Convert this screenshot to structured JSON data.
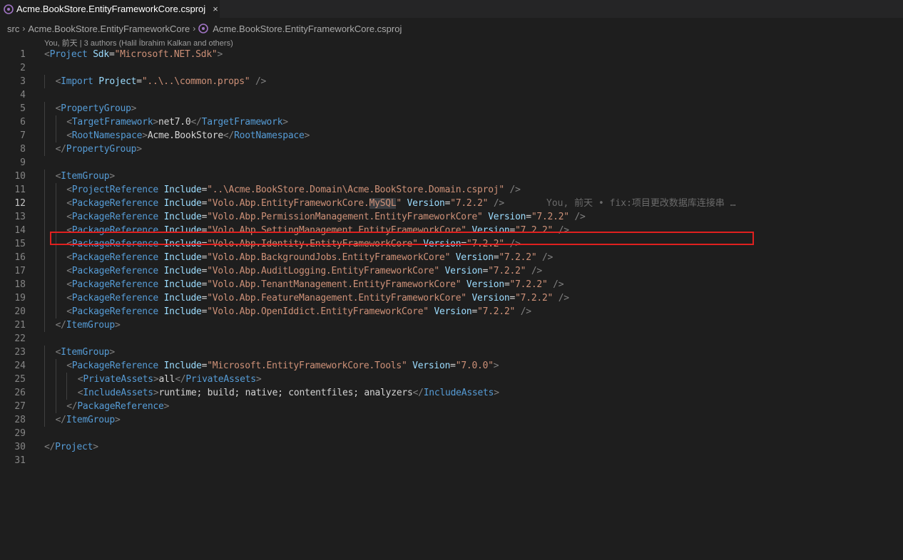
{
  "tab": {
    "icon": "csproj-file-icon",
    "title": "Acme.BookStore.EntityFrameworkCore.csproj",
    "close_glyph": "×"
  },
  "breadcrumb": {
    "items": [
      "src",
      "Acme.BookStore.EntityFrameworkCore",
      "Acme.BookStore.EntityFrameworkCore.csproj"
    ],
    "separator": "›"
  },
  "blame_header": "You, 前天 | 3 authors (Halil İbrahim Kalkan and others)",
  "inline_blame": "You, 前天 • fix:项目更改数据库连接串 …",
  "current_line": 12,
  "colors": {
    "background": "#1e1e1e",
    "tag": "#569cd6",
    "attribute": "#9cdcfe",
    "string": "#ce9178",
    "highlight_box": "#e0201f"
  },
  "lines": [
    {
      "n": "1",
      "indent": 0,
      "tokens": [
        [
          "p",
          "<"
        ],
        [
          "tag",
          "Project"
        ],
        [
          "txt",
          " "
        ],
        [
          "attr",
          "Sdk"
        ],
        [
          "eq",
          "="
        ],
        [
          "str",
          "\"Microsoft.NET.Sdk\""
        ],
        [
          "p",
          ">"
        ]
      ]
    },
    {
      "n": "2",
      "indent": 0,
      "tokens": []
    },
    {
      "n": "3",
      "indent": 1,
      "tokens": [
        [
          "p",
          "<"
        ],
        [
          "tag",
          "Import"
        ],
        [
          "txt",
          " "
        ],
        [
          "attr",
          "Project"
        ],
        [
          "eq",
          "="
        ],
        [
          "str",
          "\"..\\..\\common.props\""
        ],
        [
          "txt",
          " "
        ],
        [
          "p",
          "/>"
        ]
      ]
    },
    {
      "n": "4",
      "indent": 0,
      "tokens": []
    },
    {
      "n": "5",
      "indent": 1,
      "tokens": [
        [
          "p",
          "<"
        ],
        [
          "tag",
          "PropertyGroup"
        ],
        [
          "p",
          ">"
        ]
      ]
    },
    {
      "n": "6",
      "indent": 2,
      "tokens": [
        [
          "p",
          "<"
        ],
        [
          "tag",
          "TargetFramework"
        ],
        [
          "p",
          ">"
        ],
        [
          "txt",
          "net7.0"
        ],
        [
          "p",
          "</"
        ],
        [
          "tag",
          "TargetFramework"
        ],
        [
          "p",
          ">"
        ]
      ]
    },
    {
      "n": "7",
      "indent": 2,
      "tokens": [
        [
          "p",
          "<"
        ],
        [
          "tag",
          "RootNamespace"
        ],
        [
          "p",
          ">"
        ],
        [
          "txt",
          "Acme.BookStore"
        ],
        [
          "p",
          "</"
        ],
        [
          "tag",
          "RootNamespace"
        ],
        [
          "p",
          ">"
        ]
      ]
    },
    {
      "n": "8",
      "indent": 1,
      "tokens": [
        [
          "p",
          "</"
        ],
        [
          "tag",
          "PropertyGroup"
        ],
        [
          "p",
          ">"
        ]
      ]
    },
    {
      "n": "9",
      "indent": 0,
      "tokens": []
    },
    {
      "n": "10",
      "indent": 1,
      "tokens": [
        [
          "p",
          "<"
        ],
        [
          "tag",
          "ItemGroup"
        ],
        [
          "p",
          ">"
        ]
      ]
    },
    {
      "n": "11",
      "indent": 2,
      "tokens": [
        [
          "p",
          "<"
        ],
        [
          "tag",
          "ProjectReference"
        ],
        [
          "txt",
          " "
        ],
        [
          "attr",
          "Include"
        ],
        [
          "eq",
          "="
        ],
        [
          "str",
          "\"..\\Acme.BookStore.Domain\\Acme.BookStore.Domain.csproj\""
        ],
        [
          "txt",
          " "
        ],
        [
          "p",
          "/>"
        ]
      ]
    },
    {
      "n": "12",
      "indent": 2,
      "tokens": [
        [
          "p",
          "<"
        ],
        [
          "tag",
          "PackageReference"
        ],
        [
          "txt",
          " "
        ],
        [
          "attr",
          "Include"
        ],
        [
          "eq",
          "="
        ],
        [
          "str",
          "\"Volo.Abp.EntityFrameworkCore."
        ],
        [
          "strhl",
          "MySQL"
        ],
        [
          "str",
          "\""
        ],
        [
          "txt",
          " "
        ],
        [
          "attr",
          "Version"
        ],
        [
          "eq",
          "="
        ],
        [
          "str",
          "\"7.2.2\""
        ],
        [
          "txt",
          " "
        ],
        [
          "p",
          "/>"
        ]
      ]
    },
    {
      "n": "13",
      "indent": 2,
      "tokens": [
        [
          "p",
          "<"
        ],
        [
          "tag",
          "PackageReference"
        ],
        [
          "txt",
          " "
        ],
        [
          "attr",
          "Include"
        ],
        [
          "eq",
          "="
        ],
        [
          "str",
          "\"Volo.Abp.PermissionManagement.EntityFrameworkCore\""
        ],
        [
          "txt",
          " "
        ],
        [
          "attr",
          "Version"
        ],
        [
          "eq",
          "="
        ],
        [
          "str",
          "\"7.2.2\""
        ],
        [
          "txt",
          " "
        ],
        [
          "p",
          "/>"
        ]
      ]
    },
    {
      "n": "14",
      "indent": 2,
      "tokens": [
        [
          "p",
          "<"
        ],
        [
          "tag",
          "PackageReference"
        ],
        [
          "txt",
          " "
        ],
        [
          "attr",
          "Include"
        ],
        [
          "eq",
          "="
        ],
        [
          "str",
          "\"Volo.Abp.SettingManagement.EntityFrameworkCore\""
        ],
        [
          "txt",
          " "
        ],
        [
          "attr",
          "Version"
        ],
        [
          "eq",
          "="
        ],
        [
          "str",
          "\"7.2.2\""
        ],
        [
          "txt",
          " "
        ],
        [
          "p",
          "/>"
        ]
      ]
    },
    {
      "n": "15",
      "indent": 2,
      "tokens": [
        [
          "p",
          "<"
        ],
        [
          "tag",
          "PackageReference"
        ],
        [
          "txt",
          " "
        ],
        [
          "attr",
          "Include"
        ],
        [
          "eq",
          "="
        ],
        [
          "str",
          "\"Volo.Abp.Identity.EntityFrameworkCore\""
        ],
        [
          "txt",
          " "
        ],
        [
          "attr",
          "Version"
        ],
        [
          "eq",
          "="
        ],
        [
          "str",
          "\"7.2.2\""
        ],
        [
          "txt",
          " "
        ],
        [
          "p",
          "/>"
        ]
      ]
    },
    {
      "n": "16",
      "indent": 2,
      "tokens": [
        [
          "p",
          "<"
        ],
        [
          "tag",
          "PackageReference"
        ],
        [
          "txt",
          " "
        ],
        [
          "attr",
          "Include"
        ],
        [
          "eq",
          "="
        ],
        [
          "str",
          "\"Volo.Abp.BackgroundJobs.EntityFrameworkCore\""
        ],
        [
          "txt",
          " "
        ],
        [
          "attr",
          "Version"
        ],
        [
          "eq",
          "="
        ],
        [
          "str",
          "\"7.2.2\""
        ],
        [
          "txt",
          " "
        ],
        [
          "p",
          "/>"
        ]
      ]
    },
    {
      "n": "17",
      "indent": 2,
      "tokens": [
        [
          "p",
          "<"
        ],
        [
          "tag",
          "PackageReference"
        ],
        [
          "txt",
          " "
        ],
        [
          "attr",
          "Include"
        ],
        [
          "eq",
          "="
        ],
        [
          "str",
          "\"Volo.Abp.AuditLogging.EntityFrameworkCore\""
        ],
        [
          "txt",
          " "
        ],
        [
          "attr",
          "Version"
        ],
        [
          "eq",
          "="
        ],
        [
          "str",
          "\"7.2.2\""
        ],
        [
          "txt",
          " "
        ],
        [
          "p",
          "/>"
        ]
      ]
    },
    {
      "n": "18",
      "indent": 2,
      "tokens": [
        [
          "p",
          "<"
        ],
        [
          "tag",
          "PackageReference"
        ],
        [
          "txt",
          " "
        ],
        [
          "attr",
          "Include"
        ],
        [
          "eq",
          "="
        ],
        [
          "str",
          "\"Volo.Abp.TenantManagement.EntityFrameworkCore\""
        ],
        [
          "txt",
          " "
        ],
        [
          "attr",
          "Version"
        ],
        [
          "eq",
          "="
        ],
        [
          "str",
          "\"7.2.2\""
        ],
        [
          "txt",
          " "
        ],
        [
          "p",
          "/>"
        ]
      ]
    },
    {
      "n": "19",
      "indent": 2,
      "tokens": [
        [
          "p",
          "<"
        ],
        [
          "tag",
          "PackageReference"
        ],
        [
          "txt",
          " "
        ],
        [
          "attr",
          "Include"
        ],
        [
          "eq",
          "="
        ],
        [
          "str",
          "\"Volo.Abp.FeatureManagement.EntityFrameworkCore\""
        ],
        [
          "txt",
          " "
        ],
        [
          "attr",
          "Version"
        ],
        [
          "eq",
          "="
        ],
        [
          "str",
          "\"7.2.2\""
        ],
        [
          "txt",
          " "
        ],
        [
          "p",
          "/>"
        ]
      ]
    },
    {
      "n": "20",
      "indent": 2,
      "tokens": [
        [
          "p",
          "<"
        ],
        [
          "tag",
          "PackageReference"
        ],
        [
          "txt",
          " "
        ],
        [
          "attr",
          "Include"
        ],
        [
          "eq",
          "="
        ],
        [
          "str",
          "\"Volo.Abp.OpenIddict.EntityFrameworkCore\""
        ],
        [
          "txt",
          " "
        ],
        [
          "attr",
          "Version"
        ],
        [
          "eq",
          "="
        ],
        [
          "str",
          "\"7.2.2\""
        ],
        [
          "txt",
          " "
        ],
        [
          "p",
          "/>"
        ]
      ]
    },
    {
      "n": "21",
      "indent": 1,
      "tokens": [
        [
          "p",
          "</"
        ],
        [
          "tag",
          "ItemGroup"
        ],
        [
          "p",
          ">"
        ]
      ]
    },
    {
      "n": "22",
      "indent": 0,
      "tokens": []
    },
    {
      "n": "23",
      "indent": 1,
      "tokens": [
        [
          "p",
          "<"
        ],
        [
          "tag",
          "ItemGroup"
        ],
        [
          "p",
          ">"
        ]
      ]
    },
    {
      "n": "24",
      "indent": 2,
      "tokens": [
        [
          "p",
          "<"
        ],
        [
          "tag",
          "PackageReference"
        ],
        [
          "txt",
          " "
        ],
        [
          "attr",
          "Include"
        ],
        [
          "eq",
          "="
        ],
        [
          "str",
          "\"Microsoft.EntityFrameworkCore.Tools\""
        ],
        [
          "txt",
          " "
        ],
        [
          "attr",
          "Version"
        ],
        [
          "eq",
          "="
        ],
        [
          "str",
          "\"7.0.0\""
        ],
        [
          "p",
          ">"
        ]
      ]
    },
    {
      "n": "25",
      "indent": 3,
      "tokens": [
        [
          "p",
          "<"
        ],
        [
          "tag",
          "PrivateAssets"
        ],
        [
          "p",
          ">"
        ],
        [
          "txt",
          "all"
        ],
        [
          "p",
          "</"
        ],
        [
          "tag",
          "PrivateAssets"
        ],
        [
          "p",
          ">"
        ]
      ]
    },
    {
      "n": "26",
      "indent": 3,
      "tokens": [
        [
          "p",
          "<"
        ],
        [
          "tag",
          "IncludeAssets"
        ],
        [
          "p",
          ">"
        ],
        [
          "txt",
          "runtime; build; native; contentfiles; analyzers"
        ],
        [
          "p",
          "</"
        ],
        [
          "tag",
          "IncludeAssets"
        ],
        [
          "p",
          ">"
        ]
      ]
    },
    {
      "n": "27",
      "indent": 2,
      "tokens": [
        [
          "p",
          "</"
        ],
        [
          "tag",
          "PackageReference"
        ],
        [
          "p",
          ">"
        ]
      ]
    },
    {
      "n": "28",
      "indent": 1,
      "tokens": [
        [
          "p",
          "</"
        ],
        [
          "tag",
          "ItemGroup"
        ],
        [
          "p",
          ">"
        ]
      ]
    },
    {
      "n": "29",
      "indent": 0,
      "tokens": []
    },
    {
      "n": "30",
      "indent": 0,
      "tokens": [
        [
          "p",
          "</"
        ],
        [
          "tag",
          "Project"
        ],
        [
          "p",
          ">"
        ]
      ]
    },
    {
      "n": "31",
      "indent": 0,
      "tokens": []
    }
  ]
}
